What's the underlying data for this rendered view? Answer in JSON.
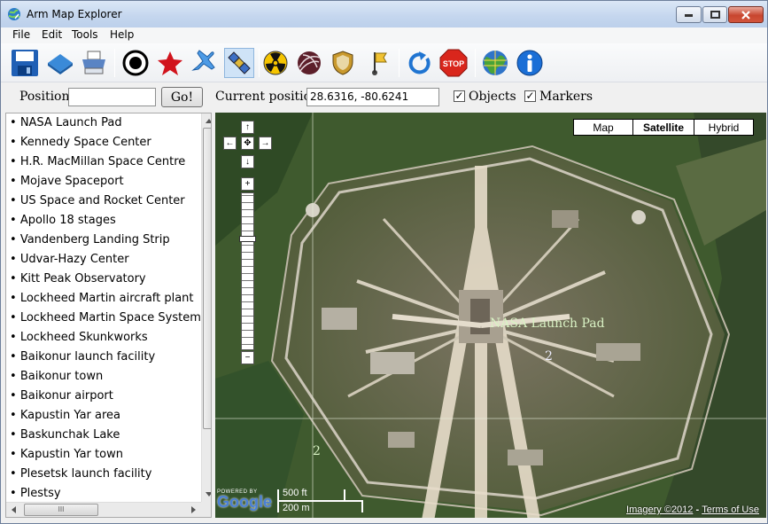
{
  "window": {
    "title": "Arm Map Explorer"
  },
  "menu": [
    "File",
    "Edit",
    "Tools",
    "Help"
  ],
  "toolbar": {
    "icons": [
      "save-icon",
      "open-icon",
      "print-icon",
      "target-icon",
      "star-icon",
      "airplane-icon",
      "satellite-icon",
      "radiation-icon",
      "hurricane-icon",
      "shield-icon",
      "flag-icon",
      "refresh-icon",
      "stop-icon",
      "globe-icon",
      "info-icon"
    ]
  },
  "position_bar": {
    "position_label": "Position:",
    "position_value": "",
    "go_label": "Go!",
    "current_label": "Current position:",
    "current_value": "28.6316, -80.6241",
    "objects_label": "Objects",
    "objects_checked": true,
    "markers_label": "Markers",
    "markers_checked": true
  },
  "list": {
    "items": [
      "NASA Launch Pad",
      "Kennedy Space Center",
      "H.R. MacMillan Space Centre",
      "Mojave Spaceport",
      "US Space and Rocket Center",
      "Apollo 18 stages",
      "Vandenberg Landing Strip",
      "Udvar-Hazy Center",
      "Kitt Peak Observatory",
      "Lockheed Martin aircraft plant",
      "Lockheed Martin Space Systems",
      "Lockheed Skunkworks",
      "Baikonur launch facility",
      "Baikonur town",
      "Baikonur airport",
      "Kapustin Yar area",
      "Baskunchak Lake",
      "Kapustin Yar town",
      "Plesetsk launch facility",
      "Plestsy"
    ],
    "hscroll_grip": "III"
  },
  "map": {
    "types": [
      "Map",
      "Satellite",
      "Hybrid"
    ],
    "active_type": "Satellite",
    "marker_label": "NASA Launch Pad",
    "grid_label_1": "2",
    "grid_label_2": "2",
    "scale_ft": "500 ft",
    "scale_m": "200 m",
    "logo_powered": "POWERED BY",
    "logo_text": "Google",
    "attrib_imagery": "Imagery ©2012",
    "attrib_sep": " - ",
    "attrib_terms": "Terms of Use",
    "zoom_level": 0.3
  }
}
